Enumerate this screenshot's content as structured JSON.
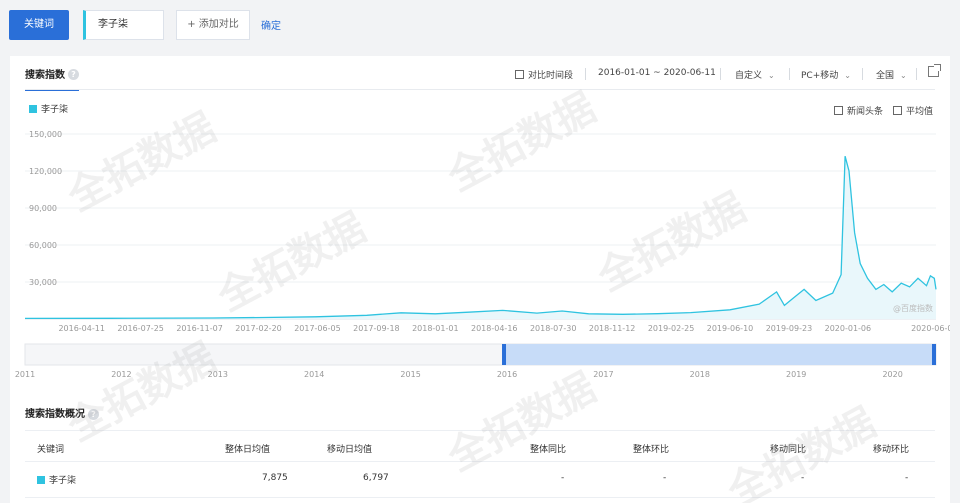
{
  "topbar": {
    "keyword_button": "关键词",
    "keyword_value": "李子柒",
    "add_compare": "+ 添加对比",
    "confirm": "确定"
  },
  "panel": {
    "tab_label": "搜索指数",
    "help": "?",
    "controls": {
      "compare_period": "对比时间段",
      "date_range": "2016-01-01 ~ 2020-06-11",
      "custom": "自定义",
      "device": "PC+移动",
      "region": "全国"
    },
    "legend_label": "李子柒",
    "news_headlines": "新闻头条",
    "average": "平均值",
    "source_mark": "@百度指数"
  },
  "chart_data": {
    "type": "area",
    "series_color": "#2fc3e0",
    "fill_color": "#e9f7fb",
    "ylim": [
      0,
      150000
    ],
    "y_ticks": [
      "150,000",
      "120,000",
      "90,000",
      "60,000",
      "30,000"
    ],
    "y_tick_values": [
      150000,
      120000,
      90000,
      60000,
      30000
    ],
    "x_ticks": [
      "2016-04-11",
      "2016-07-25",
      "2016-11-07",
      "2017-02-20",
      "2017-06-05",
      "2017-09-18",
      "2018-01-01",
      "2018-04-16",
      "2018-07-30",
      "2018-11-12",
      "2019-02-25",
      "2019-06-10",
      "2019-09-23",
      "2020-01-06",
      "2020-06-08"
    ],
    "x_tick_dates": [
      "2016-04-11",
      "2016-07-25",
      "2016-11-07",
      "2017-02-20",
      "2017-06-05",
      "2017-09-18",
      "2018-01-01",
      "2018-04-16",
      "2018-07-30",
      "2018-11-12",
      "2019-02-25",
      "2019-06-10",
      "2019-09-23",
      "2020-01-06",
      "2020-06-08"
    ],
    "points": [
      [
        "2016-01-01",
        500
      ],
      [
        "2016-06-01",
        600
      ],
      [
        "2016-12-01",
        800
      ],
      [
        "2017-03-01",
        1200
      ],
      [
        "2017-06-01",
        1800
      ],
      [
        "2017-09-01",
        3000
      ],
      [
        "2017-11-01",
        5000
      ],
      [
        "2018-01-01",
        4200
      ],
      [
        "2018-03-01",
        5500
      ],
      [
        "2018-05-01",
        7000
      ],
      [
        "2018-07-01",
        4800
      ],
      [
        "2018-08-15",
        6500
      ],
      [
        "2018-10-01",
        4200
      ],
      [
        "2018-12-01",
        3800
      ],
      [
        "2019-02-01",
        4300
      ],
      [
        "2019-04-01",
        5200
      ],
      [
        "2019-06-10",
        7500
      ],
      [
        "2019-08-01",
        12000
      ],
      [
        "2019-09-01",
        22000
      ],
      [
        "2019-09-15",
        11000
      ],
      [
        "2019-10-01",
        17000
      ],
      [
        "2019-10-20",
        24000
      ],
      [
        "2019-11-10",
        15000
      ],
      [
        "2019-12-10",
        21000
      ],
      [
        "2019-12-25",
        36000
      ],
      [
        "2020-01-01",
        132000
      ],
      [
        "2020-01-08",
        120000
      ],
      [
        "2020-01-18",
        70000
      ],
      [
        "2020-01-28",
        45000
      ],
      [
        "2020-02-10",
        33000
      ],
      [
        "2020-02-25",
        24000
      ],
      [
        "2020-03-10",
        28000
      ],
      [
        "2020-03-25",
        22000
      ],
      [
        "2020-04-10",
        29000
      ],
      [
        "2020-04-25",
        26000
      ],
      [
        "2020-05-10",
        33000
      ],
      [
        "2020-05-25",
        27000
      ],
      [
        "2020-06-01",
        35000
      ],
      [
        "2020-06-08",
        33000
      ],
      [
        "2020-06-11",
        24000
      ]
    ]
  },
  "timeline": {
    "years": [
      "2011",
      "2012",
      "2013",
      "2014",
      "2015",
      "2016",
      "2017",
      "2018",
      "2019",
      "2020"
    ],
    "selected_from": "2016",
    "selected_to": "2020"
  },
  "table": {
    "title": "搜索指数概况",
    "help": "?",
    "headers": [
      "关键词",
      "整体日均值",
      "移动日均值",
      "整体同比",
      "整体环比",
      "移动同比",
      "移动环比"
    ],
    "rows": [
      {
        "keyword": "李子柒",
        "overall_avg": "7,875",
        "mobile_avg": "6,797",
        "overall_yoy": "-",
        "overall_mom": "-",
        "mobile_yoy": "-",
        "mobile_mom": "-"
      }
    ]
  },
  "watermark_text": "全拓数据"
}
